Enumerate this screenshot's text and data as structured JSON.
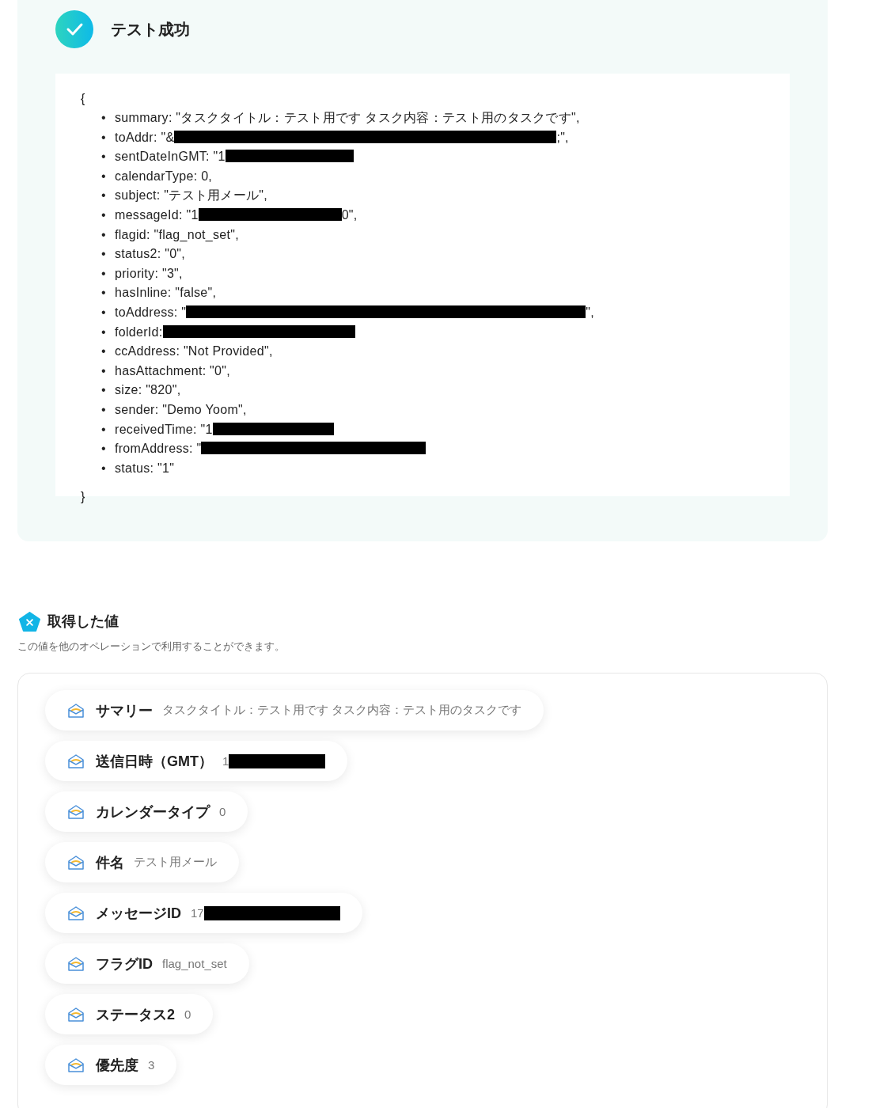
{
  "result": {
    "title": "テスト成功",
    "open_brace": "{",
    "close_brace": "}",
    "marker": "•",
    "lines": [
      {
        "text": "summary: \"タスクタイトル：テスト用です タスク内容：テスト用のタスクです\",",
        "redacted": false
      },
      {
        "text": "toAddr: \"&",
        "redacted": true,
        "after": ";\","
      },
      {
        "text": "sentDateInGMT: \"1",
        "redacted": true
      },
      {
        "text": "calendarType: 0,",
        "redacted": false
      },
      {
        "text": "subject: \"テスト用メール\",",
        "redacted": false
      },
      {
        "text": "messageId: \"1",
        "redacted": true,
        "after": "0\","
      },
      {
        "text": "flagid: \"flag_not_set\",",
        "redacted": false
      },
      {
        "text": "status2: \"0\",",
        "redacted": false
      },
      {
        "text": "priority: \"3\",",
        "redacted": false
      },
      {
        "text": "hasInline: \"false\",",
        "redacted": false
      },
      {
        "text": "toAddress: \"",
        "redacted": true,
        "after": "\","
      },
      {
        "text": "folderId:",
        "redacted": true
      },
      {
        "text": "ccAddress: \"Not Provided\",",
        "redacted": false
      },
      {
        "text": "hasAttachment: \"0\",",
        "redacted": false
      },
      {
        "text": "size: \"820\",",
        "redacted": false
      },
      {
        "text": "sender: \"Demo Yoom\",",
        "redacted": false
      },
      {
        "text": "receivedTime: \"1",
        "redacted": true
      },
      {
        "text": "fromAddress: \"",
        "redacted": true
      },
      {
        "text": "status: \"1\"",
        "redacted": false
      }
    ]
  },
  "values": {
    "title": "取得した値",
    "description": "この値を他のオペレーションで利用することができます。",
    "items": [
      {
        "label": "サマリー",
        "value": "タスクタイトル：テスト用です タスク内容：テスト用のタスクです",
        "redacted": false
      },
      {
        "label": "送信日時（GMT）",
        "value": "1",
        "redacted": true
      },
      {
        "label": "カレンダータイプ",
        "value": "0",
        "redacted": false
      },
      {
        "label": "件名",
        "value": "テスト用メール",
        "redacted": false
      },
      {
        "label": "メッセージID",
        "value": "17",
        "redacted": true
      },
      {
        "label": "フラグID",
        "value": "flag_not_set",
        "redacted": false
      },
      {
        "label": "ステータス2",
        "value": "0",
        "redacted": false
      },
      {
        "label": "優先度",
        "value": "3",
        "redacted": false
      }
    ]
  }
}
